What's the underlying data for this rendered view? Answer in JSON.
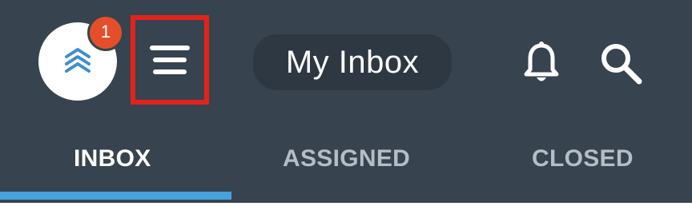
{
  "header": {
    "title": "My Inbox",
    "notification_count": "1",
    "logo_icon": "stacked-chevrons-icon",
    "menu_icon": "hamburger-menu-icon",
    "bell_icon": "bell-icon",
    "search_icon": "search-icon"
  },
  "tabs": [
    {
      "label": "INBOX",
      "selected": true
    },
    {
      "label": "ASSIGNED",
      "selected": false
    },
    {
      "label": "CLOSED",
      "selected": false
    }
  ],
  "colors": {
    "background": "#37434f",
    "title_pill": "#2d3843",
    "accent": "#44a3dc",
    "badge": "#e44f29",
    "highlight_box": "#e3231b"
  }
}
